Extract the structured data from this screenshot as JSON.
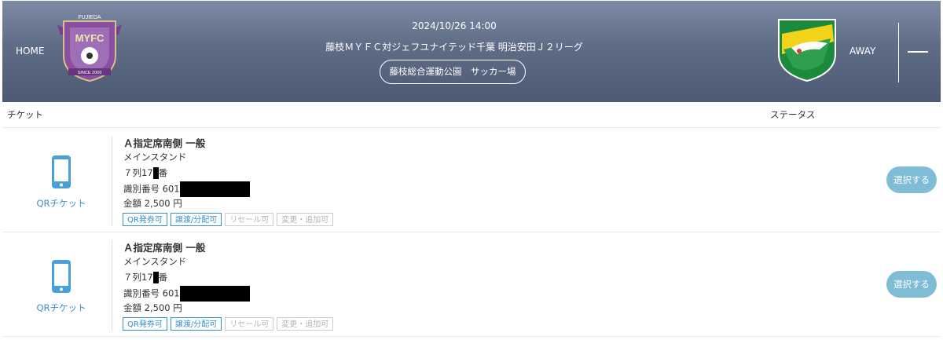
{
  "header": {
    "home_label": "HOME",
    "away_label": "AWAY",
    "date": "2024/10/26 14:00",
    "title": "藤枝ＭＹＦＣ対ジェフユナイテッド千葉 明治安田Ｊ２リーグ",
    "venue": "藤枝総合運動公園　サッカー場",
    "home_crest": {
      "top_text": "FUJIEDA",
      "center_text": "MYFC",
      "bottom_text": "SINCE 2009"
    }
  },
  "columns": {
    "ticket": "チケット",
    "status": "ステータス"
  },
  "tickets": [
    {
      "qr_label": "QRチケット",
      "name": "Ａ指定席南側 一般",
      "area": "メインスタンド",
      "seat_prefix": "７列17",
      "seat_suffix": "番",
      "id_prefix": "識別番号 601",
      "price": "金額 2,500 円",
      "tags": [
        "QR発券可",
        "譲渡/分配可",
        "リセール可",
        "変更・追加可"
      ],
      "select_label": "選択する"
    },
    {
      "qr_label": "QRチケット",
      "name": "Ａ指定席南側 一般",
      "area": "メインスタンド",
      "seat_prefix": "７列17",
      "seat_suffix": "番",
      "id_prefix": "識別番号 601",
      "price": "金額 2,500 円",
      "tags": [
        "QR発券可",
        "譲渡/分配可",
        "リセール可",
        "変更・追加可"
      ],
      "select_label": "選択する"
    }
  ],
  "colors": {
    "accent": "#3a8fc7",
    "button": "#7fbcd6",
    "header": "#5f6c86"
  }
}
